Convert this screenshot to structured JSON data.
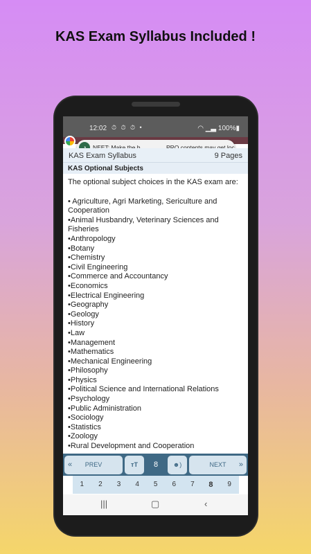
{
  "headline": "KAS Exam Syllabus Included !",
  "status": {
    "time": "12:02",
    "icons": "⏱ ⏱ ⏱ •",
    "battery": "100%"
  },
  "notification": {
    "part1": "NEET: Make the b...",
    "part2": "PRO contents may get loc..."
  },
  "doc": {
    "title": "KAS Exam Syllabus",
    "pages": "9 Pages"
  },
  "section": {
    "title": "KAS Optional Subjects",
    "intro": "The optional subject choices in the KAS exam are:",
    "items": [
      "• Agriculture, Agri Marketing, Sericulture and Cooperation",
      "•Animal Husbandry, Veterinary Sciences and Fisheries",
      "•Anthropology",
      "•Botany",
      "•Chemistry",
      "•Civil Engineering",
      "•Commerce and Accountancy",
      "•Economics",
      "•Electrical Engineering",
      "•Geography",
      "•Geology",
      "•History",
      "•Law",
      "•Management",
      "•Mathematics",
      "•Mechanical Engineering",
      "•Philosophy",
      "•Physics",
      "•Political Science and International Relations",
      "•Psychology",
      "•Public Administration",
      "•Sociology",
      "•Statistics",
      "•Zoology",
      "•Rural Development and Cooperation"
    ]
  },
  "bottom": {
    "prev": "PREV",
    "next": "NEXT",
    "text_size": "тT",
    "current_page": "8"
  },
  "pages": [
    "1",
    "2",
    "3",
    "4",
    "5",
    "6",
    "7",
    "8",
    "9"
  ],
  "active_page": "8"
}
